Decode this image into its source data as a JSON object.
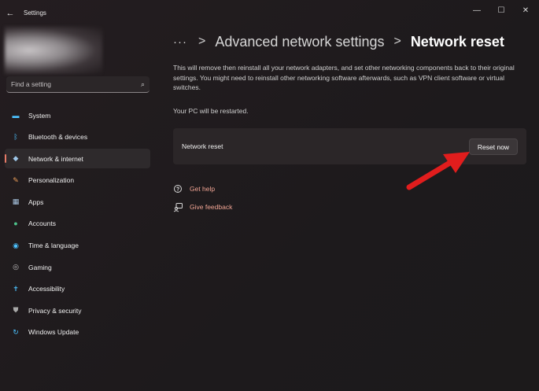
{
  "window": {
    "title": "Settings",
    "controls": {
      "minimize": "—",
      "maximize": "☐",
      "close": "✕"
    }
  },
  "search": {
    "placeholder": "Find a setting"
  },
  "sidebar": {
    "items": [
      {
        "label": "System",
        "icon": "monitor-icon",
        "color": "#4cc2ff"
      },
      {
        "label": "Bluetooth & devices",
        "icon": "bluetooth-icon",
        "color": "#4cc2ff"
      },
      {
        "label": "Network & internet",
        "icon": "wifi-icon",
        "color": "#9ec7e8",
        "active": true
      },
      {
        "label": "Personalization",
        "icon": "brush-icon",
        "color": "#f0a15a"
      },
      {
        "label": "Apps",
        "icon": "apps-icon",
        "color": "#a8c4e0"
      },
      {
        "label": "Accounts",
        "icon": "person-icon",
        "color": "#4ec38b"
      },
      {
        "label": "Time & language",
        "icon": "globe-clock-icon",
        "color": "#4cc2ff"
      },
      {
        "label": "Gaming",
        "icon": "gamepad-icon",
        "color": "#bdbdbd"
      },
      {
        "label": "Accessibility",
        "icon": "accessibility-icon",
        "color": "#4cc2ff"
      },
      {
        "label": "Privacy & security",
        "icon": "shield-icon",
        "color": "#a8a8a8"
      },
      {
        "label": "Windows Update",
        "icon": "update-icon",
        "color": "#4cc2ff"
      }
    ]
  },
  "breadcrumb": {
    "more": "···",
    "separator": ">",
    "parent": "Advanced network settings",
    "current": "Network reset"
  },
  "main": {
    "description": "This will remove then reinstall all your network adapters, and set other networking components back to their original settings. You might need to reinstall other networking software afterwards, such as VPN client software or virtual switches.",
    "restart_note": "Your PC will be restarted.",
    "card": {
      "label": "Network reset",
      "button": "Reset now"
    },
    "links": [
      {
        "label": "Get help",
        "icon": "help-icon"
      },
      {
        "label": "Give feedback",
        "icon": "feedback-icon"
      }
    ]
  },
  "colors": {
    "accent": "#e67a67",
    "link": "#f0a493",
    "annotation_arrow": "#e11d1d"
  }
}
